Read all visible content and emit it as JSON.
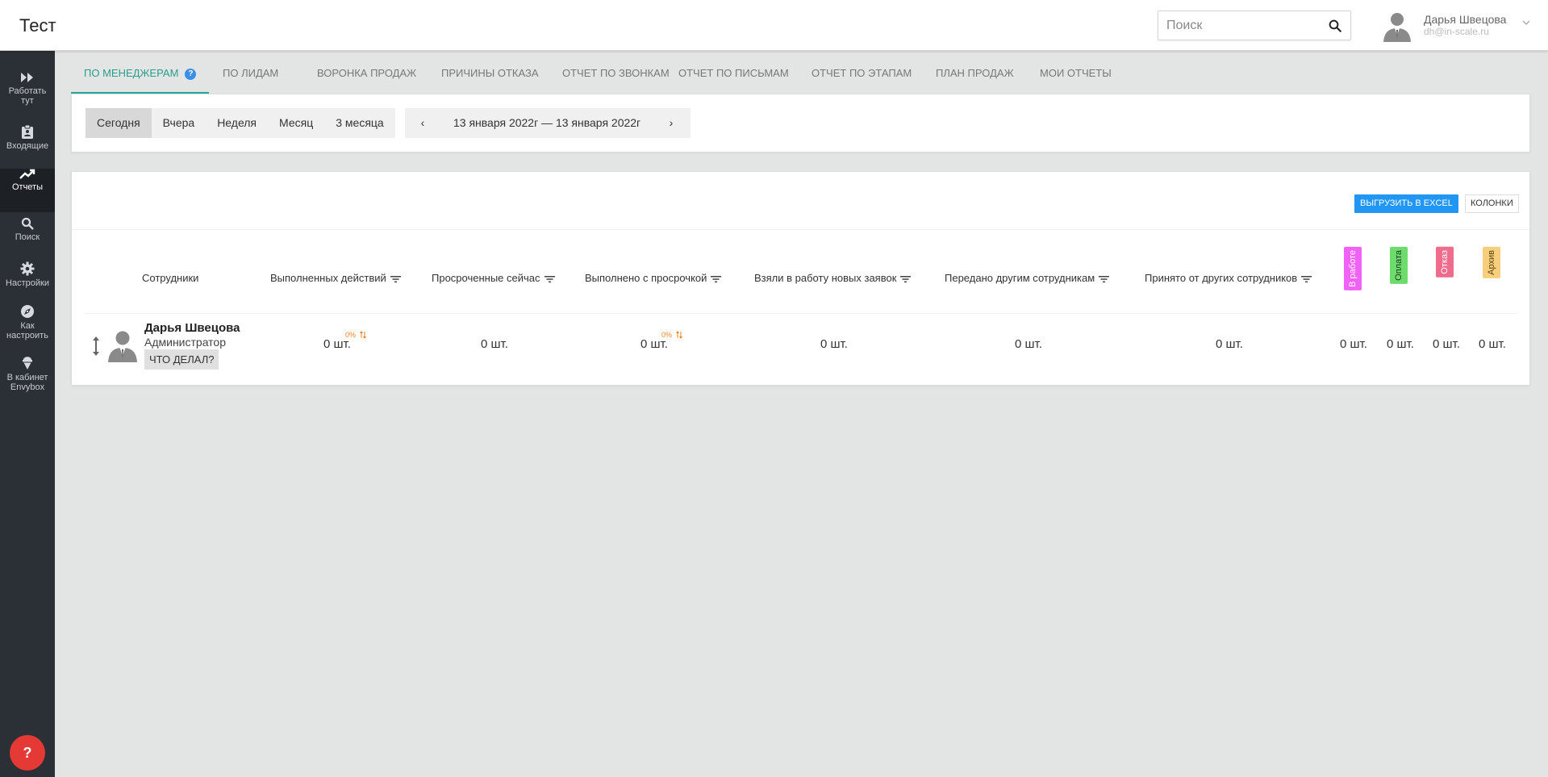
{
  "header": {
    "title": "Тест",
    "search_placeholder": "Поиск",
    "user_name": "Дарья Швецова",
    "user_email": "dh@in-scale.ru"
  },
  "sidebar": {
    "items": [
      {
        "label_line1": "Работать",
        "label_line2": "тут",
        "icon": "fast-forward-icon"
      },
      {
        "label_line1": "Входящие",
        "label_line2": "",
        "icon": "clipboard-icon"
      },
      {
        "label_line1": "Отчеты",
        "label_line2": "",
        "icon": "trending-up-icon"
      },
      {
        "label_line1": "Поиск",
        "label_line2": "",
        "icon": "search-icon"
      },
      {
        "label_line1": "Настройки",
        "label_line2": "",
        "icon": "gear-icon"
      },
      {
        "label_line1": "Как",
        "label_line2": "настроить",
        "icon": "compass-icon"
      },
      {
        "label_line1": "В кабинет",
        "label_line2": "Envybox",
        "icon": "ice-cream-icon"
      }
    ],
    "help_label": "?"
  },
  "tabs": [
    {
      "label": "ПО МЕНЕДЖЕРАМ",
      "help": "?"
    },
    {
      "label": "ПО ЛИДАМ"
    },
    {
      "label": "ВОРОНКА ПРОДАЖ"
    },
    {
      "label": "ПРИЧИНЫ ОТКАЗА"
    },
    {
      "label": "ОТЧЕТ ПО ЗВОНКАМ"
    },
    {
      "label": "ОТЧЕТ ПО ПИСЬМАМ"
    },
    {
      "label": "ОТЧЕТ ПО ЭТАПАМ"
    },
    {
      "label": "ПЛАН ПРОДАЖ"
    },
    {
      "label": "МОИ ОТЧЕТЫ"
    }
  ],
  "filters": {
    "periods": [
      "Сегодня",
      "Вчера",
      "Неделя",
      "Месяц",
      "3 месяца"
    ],
    "prev_arrow": "‹",
    "next_arrow": "›",
    "date_range": "13 января 2022г — 13 января 2022г"
  },
  "report": {
    "export_label": "ВЫГРУЗИТЬ В EXCEL",
    "columns_label": "КОЛОНКИ",
    "columns": {
      "employees": "Сотрудники",
      "actions_done": "Выполненных действий",
      "overdue_now": "Просроченные сейчас",
      "done_overdue": "Выполнено с просрочкой",
      "new_requests": "Взяли в работу новых заявок",
      "passed_to_others": "Передано другим сотрудникам",
      "received_from_others": "Принято от других сотрудников"
    },
    "statuses": [
      {
        "label": "В работе",
        "color": "#f062f5"
      },
      {
        "label": "Оплата",
        "color": "#6ddc6d"
      },
      {
        "label": "Отказ",
        "color": "#f06c8c"
      },
      {
        "label": "Архив",
        "color": "#f7cf7c"
      }
    ],
    "rows": [
      {
        "name": "Дарья Швецова",
        "role": "Администратор",
        "action_label": "ЧТО ДЕЛАЛ?",
        "actions_done": "0 шт.",
        "actions_done_pct": "0%",
        "overdue_now": "0 шт.",
        "done_overdue": "0 шт.",
        "done_overdue_pct": "0%",
        "new_requests": "0 шт.",
        "passed_to_others": "0 шт.",
        "received_from_others": "0 шт.",
        "status_values": [
          "0 шт.",
          "0 шт.",
          "0 шт.",
          "0 шт."
        ]
      }
    ]
  }
}
